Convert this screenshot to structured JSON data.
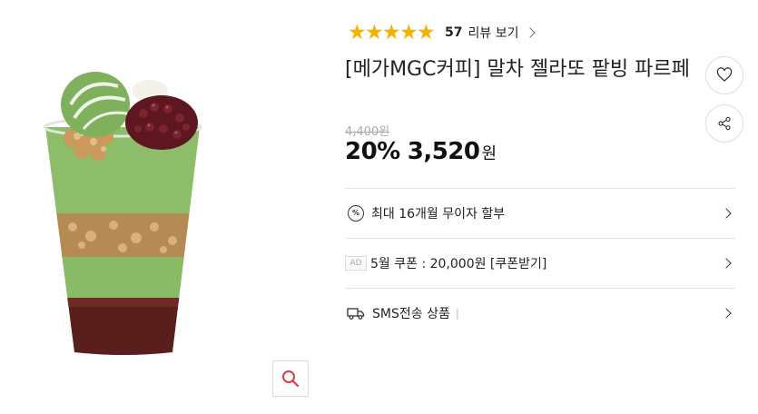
{
  "rating": {
    "stars": 5,
    "star_icon": "star-icon",
    "count": "57",
    "review_label": "리뷰 보기"
  },
  "product": {
    "title": "[메가MGC커피] 말차 젤라또 팥빙 파르페",
    "original_price": "4,400원",
    "discount": "20%",
    "sale_price": "3,520",
    "currency": "원"
  },
  "rows": {
    "installment": "최대 16개월 무이자 할부",
    "ad_badge": "AD",
    "coupon": "5월 쿠폰 : 20,000원 [쿠폰받기]",
    "sms": "SMS전송 상품",
    "sms_separator": "|"
  },
  "icons": {
    "pct_glyph": "%"
  },
  "colors": {
    "star": "#f5b300",
    "zoom_icon": "#e0394b",
    "matcha": "#8dbd6a",
    "red_bean": "#5a1f1c"
  }
}
